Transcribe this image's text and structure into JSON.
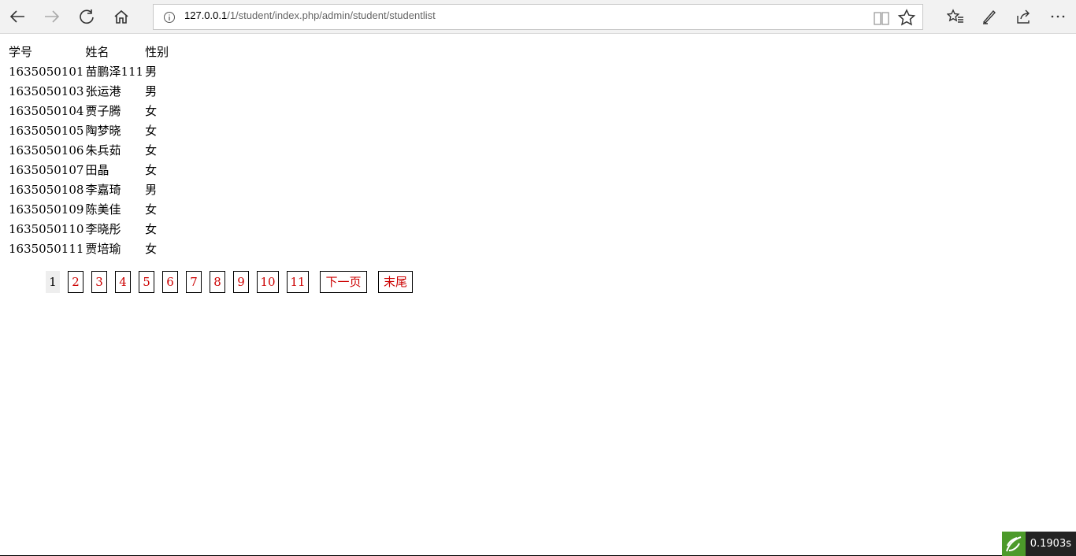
{
  "browser": {
    "url_host": "127.0.0.1",
    "url_path": "/1/student/index.php/admin/student/studentlist"
  },
  "table": {
    "headers": [
      "学号",
      "姓名",
      "性别"
    ],
    "rows": [
      [
        "1635050101",
        "苗鹏泽111",
        "男"
      ],
      [
        "1635050103",
        "张运港",
        "男"
      ],
      [
        "1635050104",
        "贾子腾",
        "女"
      ],
      [
        "1635050105",
        "陶梦晓",
        "女"
      ],
      [
        "1635050106",
        "朱兵茹",
        "女"
      ],
      [
        "1635050107",
        "田晶",
        "女"
      ],
      [
        "1635050108",
        "李嘉琦",
        "男"
      ],
      [
        "1635050109",
        "陈美佳",
        "女"
      ],
      [
        "1635050110",
        "李晓彤",
        "女"
      ],
      [
        "1635050111",
        "贾培瑜",
        "女"
      ]
    ]
  },
  "pagination": {
    "current": "1",
    "pages": [
      "2",
      "3",
      "4",
      "5",
      "6",
      "7",
      "8",
      "9",
      "10",
      "11"
    ],
    "next_label": "下一页",
    "last_label": "末尾",
    "link_color": "#cc0000"
  },
  "trace": {
    "time": "0.1903s"
  }
}
